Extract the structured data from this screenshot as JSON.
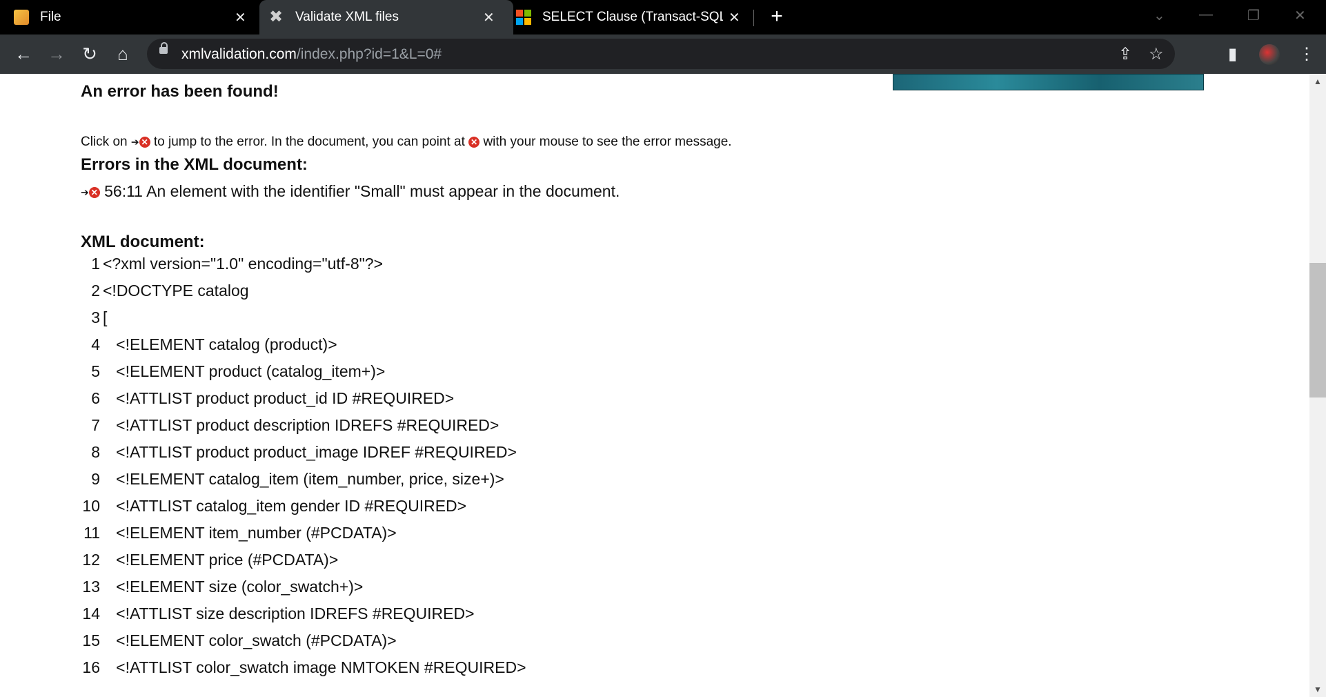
{
  "tabs": [
    {
      "title": "File",
      "favicon": "pencil-icon"
    },
    {
      "title": "Validate XML files",
      "favicon": "xml-validator-icon"
    },
    {
      "title": "SELECT Clause (Transact-SQL) - S",
      "favicon": "microsoft-icon"
    }
  ],
  "new_tab": "+",
  "window_controls": {
    "dropdown": "⌄",
    "minimize": "—",
    "restore": "❐",
    "close": "✕"
  },
  "toolbar": {
    "back": "←",
    "forward": "→",
    "reload": "↻",
    "home": "⌂",
    "url_domain": "xmlvalidation.com",
    "url_path": "/index.php?id=1&L=0#",
    "share": "⇪",
    "bookmark": "☆",
    "sidebar": "▮",
    "menu": "⋮"
  },
  "page": {
    "error_heading": "An error has been found!",
    "hint_part1": "Click on",
    "hint_part2": "to jump to the error. In the document, you can point at",
    "hint_part3": "with your mouse to see the error message.",
    "errors_heading": "Errors in the XML document:",
    "error_location": "56:11",
    "error_message": "An element with the identifier \"Small\" must appear in the document.",
    "xml_heading": "XML document:",
    "lines": [
      {
        "n": "1",
        "t": "<?xml version=\"1.0\" encoding=\"utf-8\"?>"
      },
      {
        "n": "2",
        "t": "<!DOCTYPE catalog"
      },
      {
        "n": "3",
        "t": "["
      },
      {
        "n": "4",
        "t": "   <!ELEMENT catalog (product)>"
      },
      {
        "n": "5",
        "t": "   <!ELEMENT product (catalog_item+)>"
      },
      {
        "n": "6",
        "t": "   <!ATTLIST product product_id ID #REQUIRED>"
      },
      {
        "n": "7",
        "t": "   <!ATTLIST product description IDREFS #REQUIRED>"
      },
      {
        "n": "8",
        "t": "   <!ATTLIST product product_image IDREF #REQUIRED>"
      },
      {
        "n": "9",
        "t": "   <!ELEMENT catalog_item (item_number, price, size+)>"
      },
      {
        "n": "10",
        "t": "   <!ATTLIST catalog_item gender ID #REQUIRED>"
      },
      {
        "n": "11",
        "t": "   <!ELEMENT item_number (#PCDATA)>"
      },
      {
        "n": "12",
        "t": "   <!ELEMENT price (#PCDATA)>"
      },
      {
        "n": "13",
        "t": "   <!ELEMENT size (color_swatch+)>"
      },
      {
        "n": "14",
        "t": "   <!ATTLIST size description IDREFS #REQUIRED>"
      },
      {
        "n": "15",
        "t": "   <!ELEMENT color_swatch (#PCDATA)>"
      },
      {
        "n": "16",
        "t": "   <!ATTLIST color_swatch image NMTOKEN #REQUIRED>"
      }
    ]
  },
  "colors": {
    "tabbar": "#000000",
    "toolbar": "#323639",
    "omnibox": "#202124",
    "error_icon": "#d93025"
  }
}
